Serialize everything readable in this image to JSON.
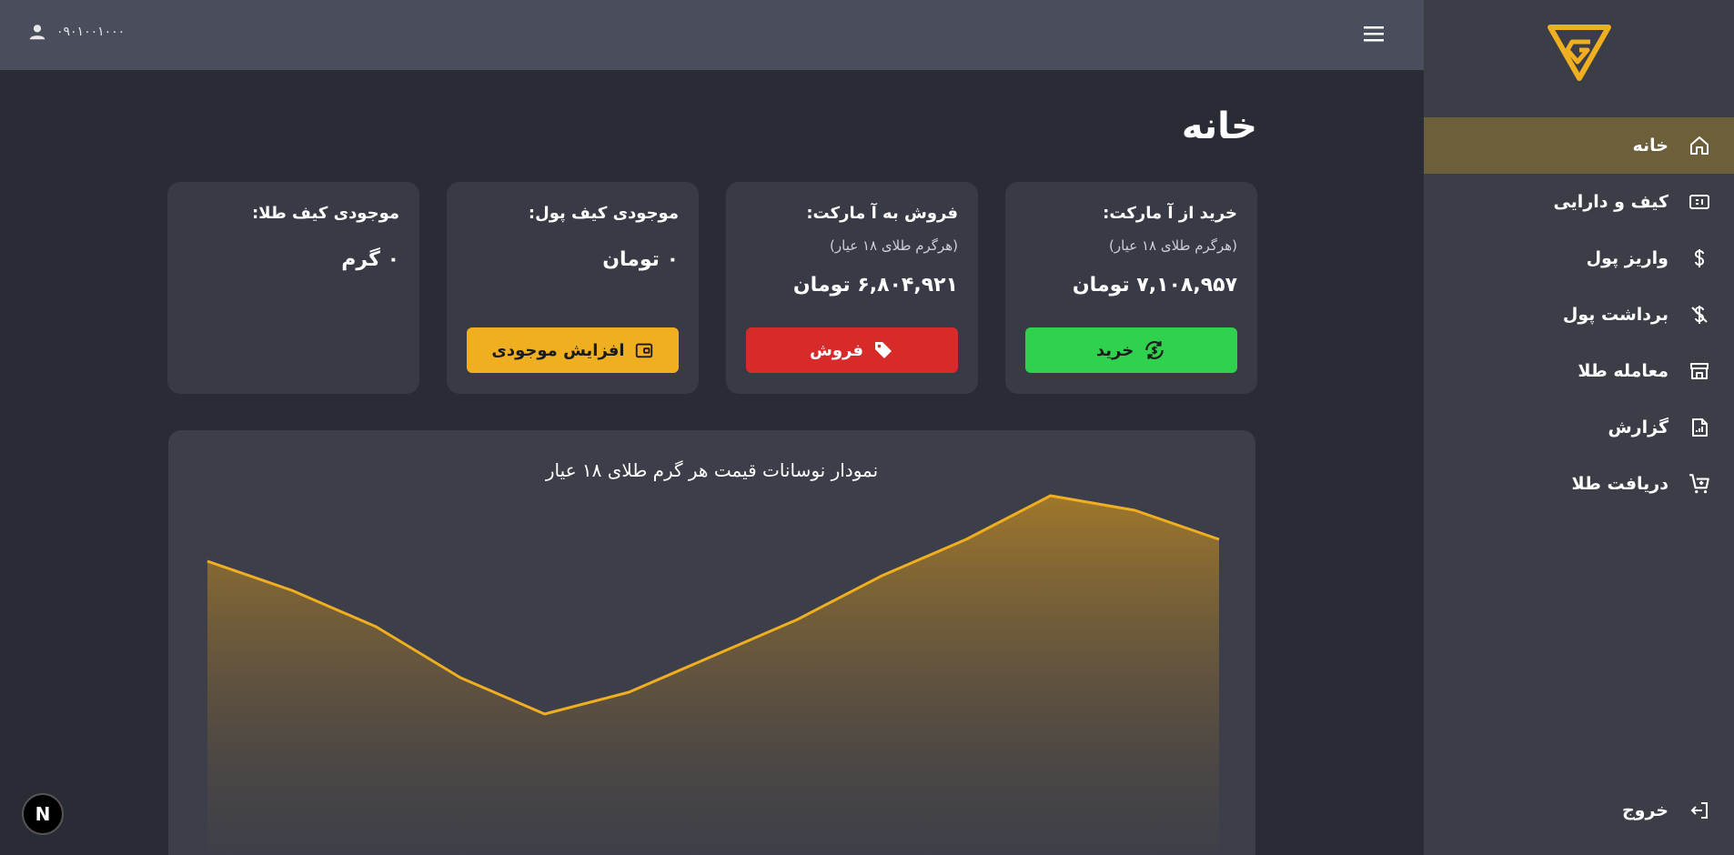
{
  "user": {
    "phone": "۰۹۰۱۰۰۱۰۰۰"
  },
  "page": {
    "title": "خانه"
  },
  "sidebar": {
    "items": [
      {
        "label": "خانه",
        "icon": "home-icon",
        "active": true
      },
      {
        "label": "کیف و دارایی",
        "icon": "wallet-card-icon",
        "active": false
      },
      {
        "label": "واریز پول",
        "icon": "dollar-icon",
        "active": false
      },
      {
        "label": "برداشت پول",
        "icon": "dollar-off-icon",
        "active": false
      },
      {
        "label": "معامله طلا",
        "icon": "store-icon",
        "active": false
      },
      {
        "label": "گزارش",
        "icon": "report-icon",
        "active": false
      },
      {
        "label": "دریافت طلا",
        "icon": "cart-add-icon",
        "active": false
      }
    ],
    "logout": {
      "label": "خروج",
      "icon": "logout-icon"
    }
  },
  "cards": {
    "buy": {
      "title": "خرید از آ مارکت:",
      "subtitle": "(هرگرم طلای ۱۸ عیار)",
      "value": "۷,۱۰۸,۹۵۷ تومان",
      "button": "خرید"
    },
    "sell": {
      "title": "فروش به آ مارکت:",
      "subtitle": "(هرگرم طلای ۱۸ عیار)",
      "value": "۶,۸۰۴,۹۲۱ تومان",
      "button": "فروش"
    },
    "wallet": {
      "title": "موجودی کیف پول:",
      "value": "۰ تومان",
      "button": "افزایش موجودی"
    },
    "gold": {
      "title": "موجودی کیف طلا:",
      "value": "۰ گرم"
    }
  },
  "colors": {
    "accent": "#f0ae21",
    "buy": "#2fd14d",
    "sell": "#d92a2a",
    "active_nav": "#6c5f3a"
  },
  "chart_data": {
    "type": "area",
    "title": "نمودار نوسانات قیمت هر گرم طلای ۱۸ عیار",
    "xlabel": "",
    "ylabel": "",
    "grid": false,
    "series": [
      {
        "values": [
          0.42,
          0.38,
          0.33,
          0.26,
          0.21,
          0.24,
          0.29,
          0.34,
          0.4,
          0.45,
          0.51,
          0.49,
          0.45
        ]
      }
    ],
    "ylim": [
      0,
      0.6
    ]
  },
  "badge": {
    "label": "N"
  }
}
